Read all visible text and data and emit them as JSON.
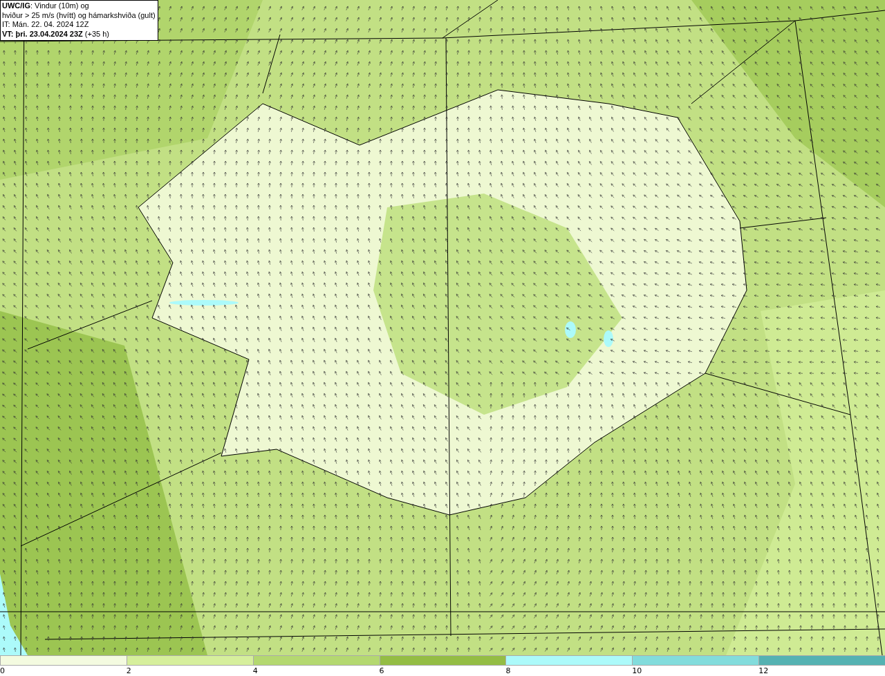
{
  "info_box": {
    "lines": [
      "**UWC/IG**: Vindur (10m) og",
      "hviður > 25 m/s (hvítt) og hámarkshviða (gult)",
      "IT: Mán. 22. 04. 2024 12Z",
      "**VT: þri. 23.04.2024 23Z** (+35 h)"
    ]
  },
  "color_scale": [
    {
      "label": "0",
      "color": "#f4fbe0"
    },
    {
      "label": "2",
      "color": "#d6ef9c"
    },
    {
      "label": "4",
      "color": "#b4d870"
    },
    {
      "label": "6",
      "color": "#94bd44"
    },
    {
      "label": "8",
      "color": "#acfafa"
    },
    {
      "label": "10",
      "color": "#82dcdc"
    },
    {
      "label": "12",
      "color": "#55b2b2"
    }
  ]
}
